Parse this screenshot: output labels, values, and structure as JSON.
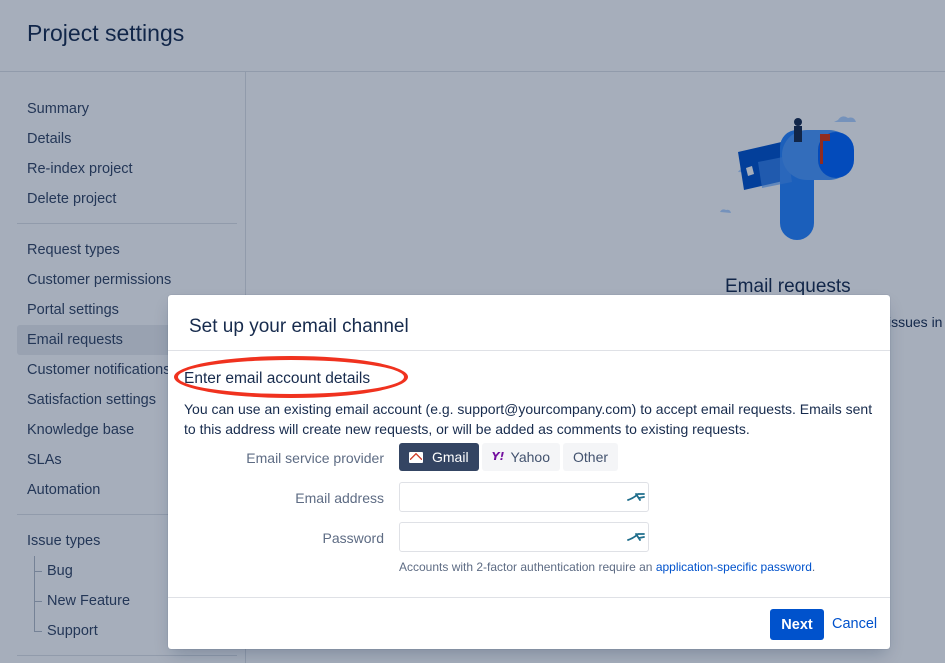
{
  "page": {
    "title": "Project settings"
  },
  "sidebar": {
    "group1": [
      "Summary",
      "Details",
      "Re-index project",
      "Delete project"
    ],
    "group2": [
      "Request types",
      "Customer permissions",
      "Portal settings",
      "Email requests",
      "Customer notifications",
      "Satisfaction settings",
      "Knowledge base",
      "SLAs",
      "Automation"
    ],
    "active_item": "Email requests",
    "issue_types_label": "Issue types",
    "issue_types": [
      "Bug",
      "New Feature",
      "Support"
    ]
  },
  "hero": {
    "title": "Email requests",
    "text_fragment": "issues in y"
  },
  "modal": {
    "title": "Set up your email channel",
    "section_heading": "Enter email account details",
    "description": "You can use an existing email account (e.g. support@yourcompany.com) to accept email requests. Emails sent to this address will create new requests, or will be added as comments to existing requests.",
    "provider_label": "Email service provider",
    "providers": [
      {
        "label": "Gmail",
        "icon": "gmail-icon",
        "selected": true
      },
      {
        "label": "Yahoo",
        "icon": "yahoo-icon",
        "selected": false
      },
      {
        "label": "Other",
        "icon": "",
        "selected": false
      }
    ],
    "email_label": "Email address",
    "email_value": "",
    "password_label": "Password",
    "password_value": "",
    "hint_prefix": "Accounts with 2-factor authentication require an ",
    "hint_link": "application-specific password",
    "hint_suffix": ".",
    "next_label": "Next",
    "cancel_label": "Cancel"
  },
  "colors": {
    "primary": "#0052cc",
    "selected_provider": "#344563",
    "annotation_red": "#f0321f"
  }
}
